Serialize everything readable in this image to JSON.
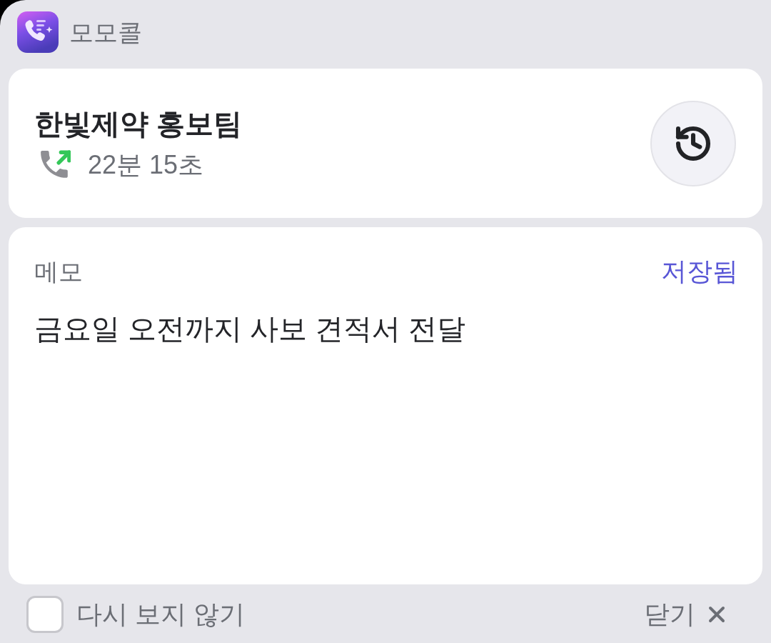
{
  "app": {
    "name": "모모콜"
  },
  "call": {
    "contact": "한빛제약 홍보팀",
    "outgoing": true,
    "duration": "22분 15초"
  },
  "memo": {
    "label": "메모",
    "status": "저장됨",
    "text": "금요일 오전까지 사보 견적서 전달"
  },
  "footer": {
    "dont_show_again": {
      "label": "다시 보지 않기",
      "checked": false
    },
    "close": {
      "label": "닫기"
    }
  }
}
